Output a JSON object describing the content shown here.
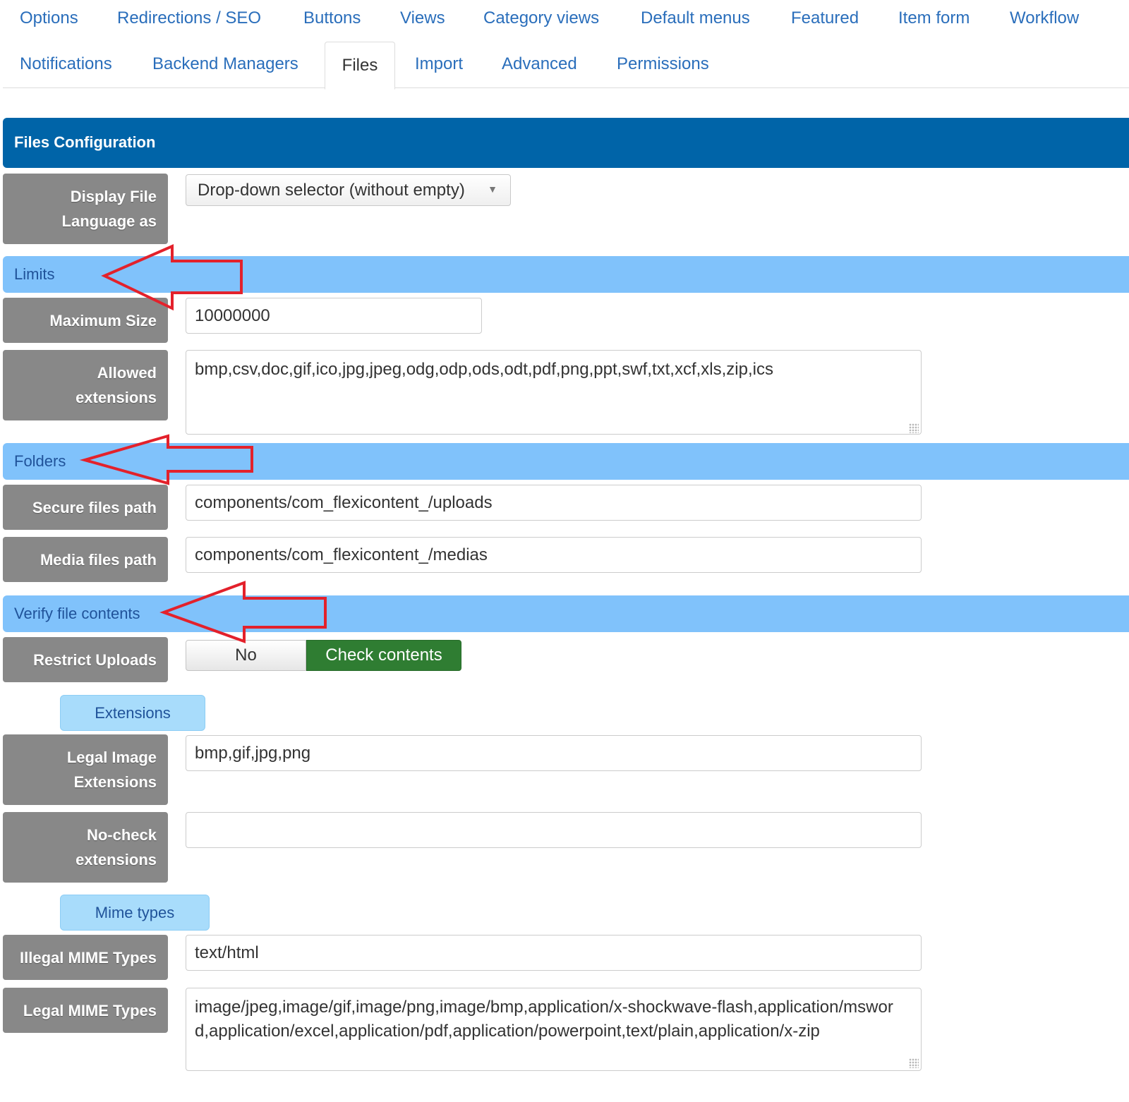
{
  "tabs": {
    "row1": [
      "Options",
      "Redirections / SEO",
      "Buttons",
      "Views",
      "Category views",
      "Default menus",
      "Featured",
      "Item form",
      "Workflow"
    ],
    "row2": [
      "Notifications",
      "Backend Managers",
      "Files",
      "Import",
      "Advanced",
      "Permissions"
    ],
    "active": "Files"
  },
  "header": {
    "title": "Files Configuration"
  },
  "display_language": {
    "label": "Display File Language as",
    "selected": "Drop-down selector (without empty)"
  },
  "limits": {
    "title": "Limits",
    "max_size_label": "Maximum Size",
    "max_size_value": "10000000",
    "allowed_ext_label": "Allowed extensions",
    "allowed_ext_value": "bmp,csv,doc,gif,ico,jpg,jpeg,odg,odp,ods,odt,pdf,png,ppt,swf,txt,xcf,xls,zip,ics"
  },
  "folders": {
    "title": "Folders",
    "secure_label": "Secure files path",
    "secure_value": "components/com_flexicontent_/uploads",
    "media_label": "Media files path",
    "media_value": "components/com_flexicontent_/medias"
  },
  "verify": {
    "title": "Verify file contents",
    "restrict_label": "Restrict Uploads",
    "option_no": "No",
    "option_yes": "Check contents",
    "selected": "Check contents",
    "extensions_title": "Extensions",
    "legal_image_label": "Legal Image Extensions",
    "legal_image_value": "bmp,gif,jpg,png",
    "nocheck_label": "No-check extensions",
    "nocheck_value": "",
    "mime_title": "Mime types",
    "illegal_mime_label": "Illegal MIME Types",
    "illegal_mime_value": "text/html",
    "legal_mime_label": "Legal MIME Types",
    "legal_mime_value": "image/jpeg,image/gif,image/png,image/bmp,application/x-shockwave-flash,application/msword,application/excel,application/pdf,application/powerpoint,text/plain,application/x-zip"
  },
  "colors": {
    "header_bg": "#0064a8",
    "section_bg": "#80c2fb",
    "label_bg": "#888888",
    "toggle_active": "#2f7d32",
    "arrow": "#e3212b"
  }
}
